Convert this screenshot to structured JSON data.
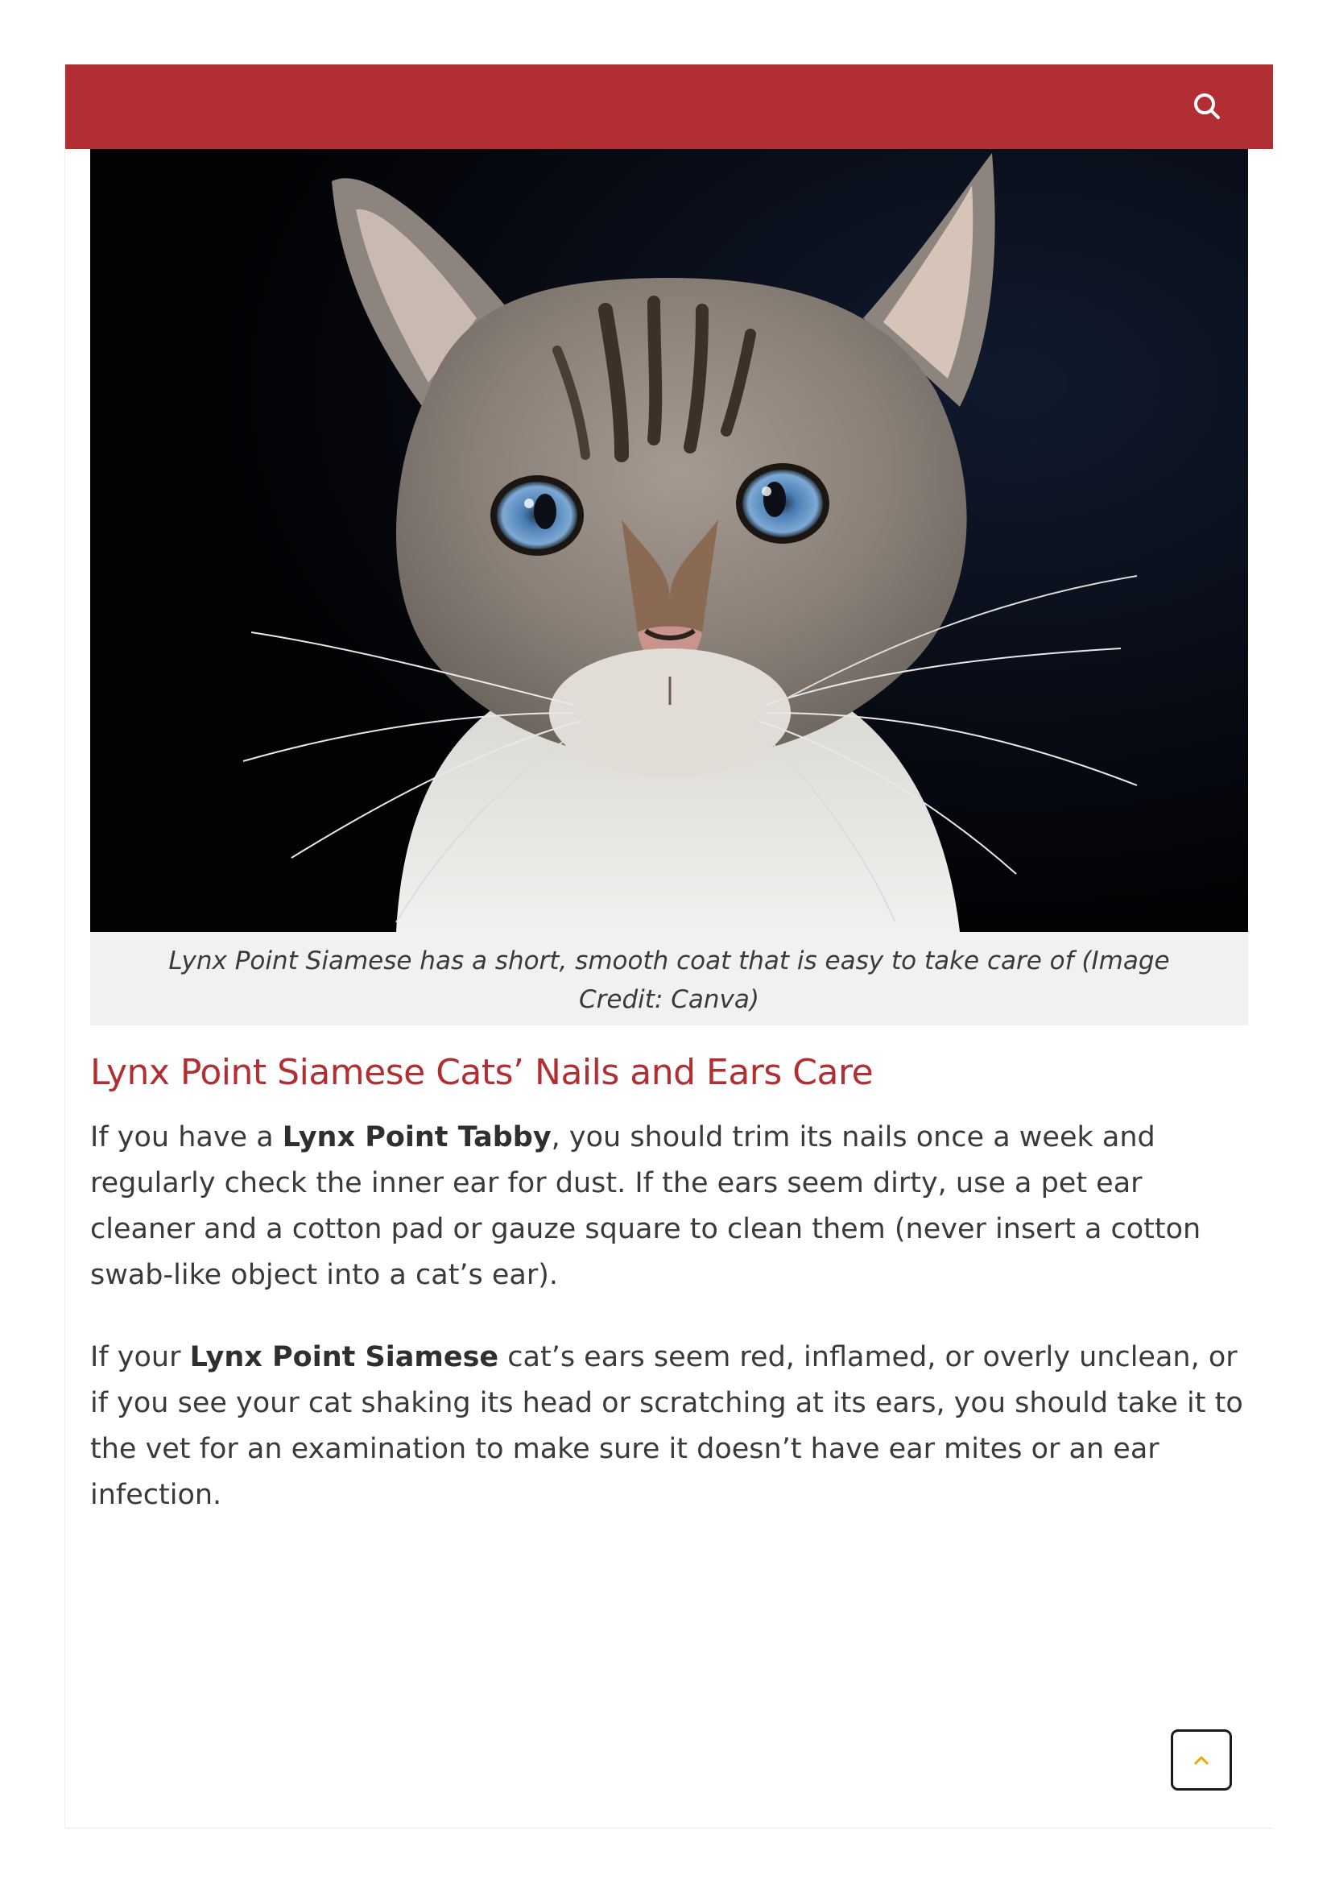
{
  "header": {
    "background_color": "#b12e33",
    "search_icon": "search-icon"
  },
  "figure": {
    "image_subject": "Lynx Point Siamese cat portrait",
    "caption": "Lynx Point Siamese has a short, smooth coat that is easy to take care of (Image Credit: Canva)"
  },
  "article": {
    "heading": "Lynx Point Siamese Cats’ Nails and Ears Care",
    "heading_color": "#b12e33",
    "paragraph1": {
      "before": "If you have a ",
      "strong": "Lynx Point Tabby",
      "after": ", you should trim its nails once a week and regularly check the inner ear for dust. If the ears seem dirty, use a pet ear cleaner and a cotton pad or gauze square to clean them (never insert a cotton swab-like object into a cat’s ear)."
    },
    "paragraph2": {
      "before": "If your ",
      "strong": "Lynx Point Siamese",
      "after": " cat’s ears seem red, inflamed, or overly unclean, or if you see your cat shaking its head or scratching at its ears, you should take it to the vet for an examination to make sure it doesn’t have ear mites or an ear infection."
    }
  },
  "scroll_to_top": {
    "icon": "chevron-up-icon",
    "accent_color": "#f0a500"
  }
}
